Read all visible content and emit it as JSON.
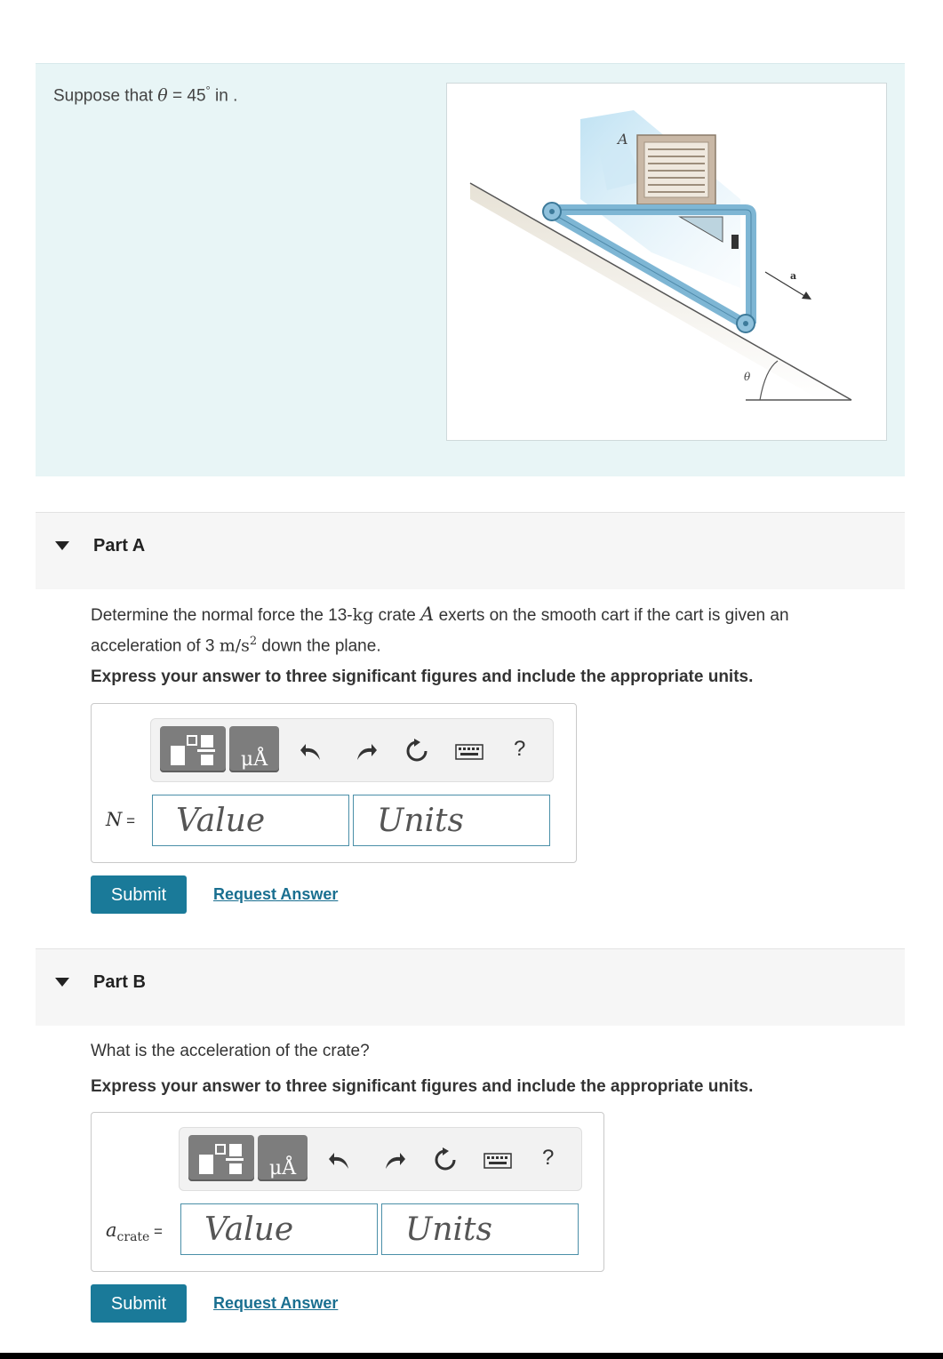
{
  "intro": {
    "text_prefix": "Suppose that ",
    "theta_symbol": "θ",
    "text_value": " = 45",
    "degree": "°",
    "text_suffix": " in ."
  },
  "figure": {
    "crate_label": "A",
    "accel_label": "a",
    "angle_label": "θ"
  },
  "toolbar": {
    "units_icon_text": "μÅ",
    "help_label": "?",
    "icons": [
      "templates-icon",
      "units-icon",
      "undo-icon",
      "redo-icon",
      "reset-icon",
      "keyboard-icon",
      "help-icon"
    ]
  },
  "partA": {
    "title": "Part A",
    "question_1": "Determine the normal force the 13-",
    "question_kg": "kg",
    "question_2": " crate ",
    "question_A": "A",
    "question_3": " exerts on the smooth cart if the cart is given an",
    "question_4": "acceleration of 3 ",
    "question_unit": "m/s",
    "question_exp": "2",
    "question_5": " down the plane.",
    "instruction": "Express your answer to three significant figures and include the appropriate units.",
    "var_label": "N",
    "eq": " =",
    "value_placeholder": "Value",
    "units_placeholder": "Units",
    "submit_label": "Submit",
    "request_label": "Request Answer"
  },
  "partB": {
    "title": "Part B",
    "question": "What is the acceleration of the crate?",
    "instruction": "Express your answer to three significant figures and include the appropriate units.",
    "var_label": "a",
    "var_sub": "crate",
    "eq": " =",
    "value_placeholder": "Value",
    "units_placeholder": "Units",
    "submit_label": "Submit",
    "request_label": "Request Answer"
  },
  "colors": {
    "intro_bg": "#e8f5f6",
    "accent": "#1a7a99",
    "link": "#1a6f90",
    "toolbar_dark": "#7d7d7d"
  }
}
